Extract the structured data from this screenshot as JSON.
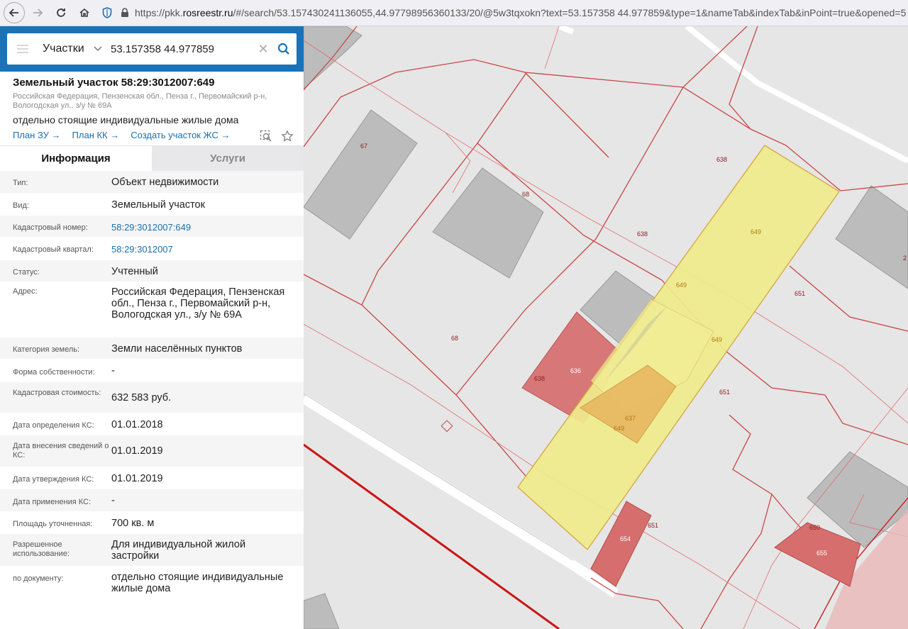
{
  "browser": {
    "url_prefix": "https://pkk.",
    "url_host": "rosreestr.ru",
    "url_rest": "/#/search/53.157430241136055,44.97798956360133/20/@5w3tqxokn?text=53.157358 44.977859&type=1&nameTab&indexTab&inPoint=true&opened=5"
  },
  "search": {
    "type_label": "Участки",
    "query": "53.157358 44.977859"
  },
  "parcel": {
    "title": "Земельный участок 58:29:3012007:649",
    "address_line": "Российская Федерация, Пензенская обл., Пенза г., Первомайский р-н, Вологодская ул., з/у № 69А",
    "use": "отдельно стоящие индивидуальные жилые дома",
    "links": [
      "План ЗУ →",
      "План КК →",
      "Создать участок ЖС →"
    ]
  },
  "tabs": [
    {
      "label": "Информация",
      "active": true
    },
    {
      "label": "Услуги",
      "active": false
    }
  ],
  "info": [
    {
      "label": "Тип:",
      "value": "Объект недвижимости",
      "link": false
    },
    {
      "label": "Вид:",
      "value": "Земельный участок",
      "link": false
    },
    {
      "label": "Кадастровый номер:",
      "value": "58:29:3012007:649",
      "link": true
    },
    {
      "label": "Кадастровый квартал:",
      "value": "58:29:3012007",
      "link": true
    },
    {
      "label": "Статус:",
      "value": "Учтенный",
      "link": false
    },
    {
      "label": "Адрес:",
      "value": "Российская Федерация, Пензенская обл., Пенза г., Первомайский р-н, Вологодская ул., з/у № 69А",
      "link": false
    },
    {
      "label": "Категория земель:",
      "value": "Земли населённых пунктов",
      "link": false
    },
    {
      "label": "Форма собственности:",
      "value": "-",
      "link": false
    },
    {
      "label": "Кадастровая стоимость:",
      "value": "632 583 руб.",
      "link": false
    },
    {
      "label": "Дата определения КС:",
      "value": "01.01.2018",
      "link": false
    },
    {
      "label": "Дата внесения сведений о КС:",
      "value": "01.01.2019",
      "link": false
    },
    {
      "label": "Дата утверждения КС:",
      "value": "01.01.2019",
      "link": false
    },
    {
      "label": "Дата применения КС:",
      "value": "-",
      "link": false
    },
    {
      "label": "Площадь уточненная:",
      "value": "700 кв. м",
      "link": false
    },
    {
      "label": "Разрешенное использование:",
      "value": "Для индивидуальной жилой застройки",
      "link": false
    },
    {
      "label": "по документу:",
      "value": "отдельно стоящие индивидуальные жилые дома",
      "link": false
    }
  ],
  "map": {
    "labels": {
      "l67": "67",
      "l68a": "68",
      "l68b": "68",
      "l638a": "638",
      "l638b": "638",
      "l638c": "638",
      "l649a": "649",
      "l649b": "649",
      "l649c": "649",
      "l649d": "649",
      "l651a": "651",
      "l651b": "651",
      "l651c": "651",
      "l636": "636",
      "l637": "637",
      "l654": "654",
      "l650": "650",
      "l655": "655",
      "l2": "2"
    }
  },
  "colors": {
    "accent": "#1a73b8",
    "link": "#1a6fae",
    "selected_parcel": "#f0ec8c",
    "boundary": "#c94646",
    "building": "#bcbcbc"
  }
}
